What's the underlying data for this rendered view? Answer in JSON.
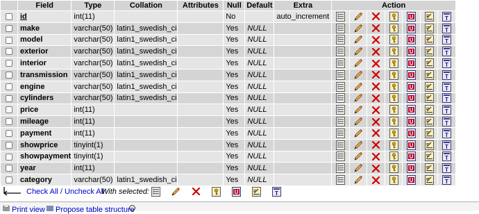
{
  "headers": {
    "field": "Field",
    "type": "Type",
    "collation": "Collation",
    "attributes": "Attributes",
    "null": "Null",
    "default": "Default",
    "extra": "Extra",
    "action": "Action"
  },
  "rows": [
    {
      "field": "id",
      "type": "int(11)",
      "collation": "",
      "attributes": "",
      "null": "No",
      "default": "",
      "extra": "auto_increment"
    },
    {
      "field": "make",
      "type": "varchar(50)",
      "collation": "latin1_swedish_ci",
      "attributes": "",
      "null": "Yes",
      "default": "NULL",
      "extra": ""
    },
    {
      "field": "model",
      "type": "varchar(50)",
      "collation": "latin1_swedish_ci",
      "attributes": "",
      "null": "Yes",
      "default": "NULL",
      "extra": ""
    },
    {
      "field": "exterior",
      "type": "varchar(50)",
      "collation": "latin1_swedish_ci",
      "attributes": "",
      "null": "Yes",
      "default": "NULL",
      "extra": ""
    },
    {
      "field": "interior",
      "type": "varchar(50)",
      "collation": "latin1_swedish_ci",
      "attributes": "",
      "null": "Yes",
      "default": "NULL",
      "extra": ""
    },
    {
      "field": "transmission",
      "type": "varchar(50)",
      "collation": "latin1_swedish_ci",
      "attributes": "",
      "null": "Yes",
      "default": "NULL",
      "extra": ""
    },
    {
      "field": "engine",
      "type": "varchar(50)",
      "collation": "latin1_swedish_ci",
      "attributes": "",
      "null": "Yes",
      "default": "NULL",
      "extra": ""
    },
    {
      "field": "cylinders",
      "type": "varchar(50)",
      "collation": "latin1_swedish_ci",
      "attributes": "",
      "null": "Yes",
      "default": "NULL",
      "extra": ""
    },
    {
      "field": "price",
      "type": "int(11)",
      "collation": "",
      "attributes": "",
      "null": "Yes",
      "default": "NULL",
      "extra": ""
    },
    {
      "field": "mileage",
      "type": "int(11)",
      "collation": "",
      "attributes": "",
      "null": "Yes",
      "default": "NULL",
      "extra": ""
    },
    {
      "field": "payment",
      "type": "int(11)",
      "collation": "",
      "attributes": "",
      "null": "Yes",
      "default": "NULL",
      "extra": ""
    },
    {
      "field": "showprice",
      "type": "tinyint(1)",
      "collation": "",
      "attributes": "",
      "null": "Yes",
      "default": "NULL",
      "extra": ""
    },
    {
      "field": "showpayment",
      "type": "tinyint(1)",
      "collation": "",
      "attributes": "",
      "null": "Yes",
      "default": "NULL",
      "extra": ""
    },
    {
      "field": "year",
      "type": "int(11)",
      "collation": "",
      "attributes": "",
      "null": "Yes",
      "default": "NULL",
      "extra": ""
    },
    {
      "field": "category",
      "type": "varchar(50)",
      "collation": "latin1_swedish_ci",
      "attributes": "",
      "null": "Yes",
      "default": "NULL",
      "extra": ""
    }
  ],
  "actions": [
    "browse-icon",
    "edit-icon",
    "drop-icon",
    "primary-key-icon",
    "unique-icon",
    "index-icon",
    "fulltext-icon"
  ],
  "footer": {
    "check_all": "Check All",
    "separator": " / ",
    "uncheck_all": "Uncheck All",
    "with_selected": "With selected:"
  },
  "bottom": {
    "print_view": "Print view",
    "propose": "Propose table structure"
  },
  "colors": {
    "header_bg": "#d4d4d4",
    "row_odd": "#e5e5e5",
    "row_even": "#d5d5d5",
    "link": "#0000cc",
    "drop_red": "#cc0000"
  }
}
